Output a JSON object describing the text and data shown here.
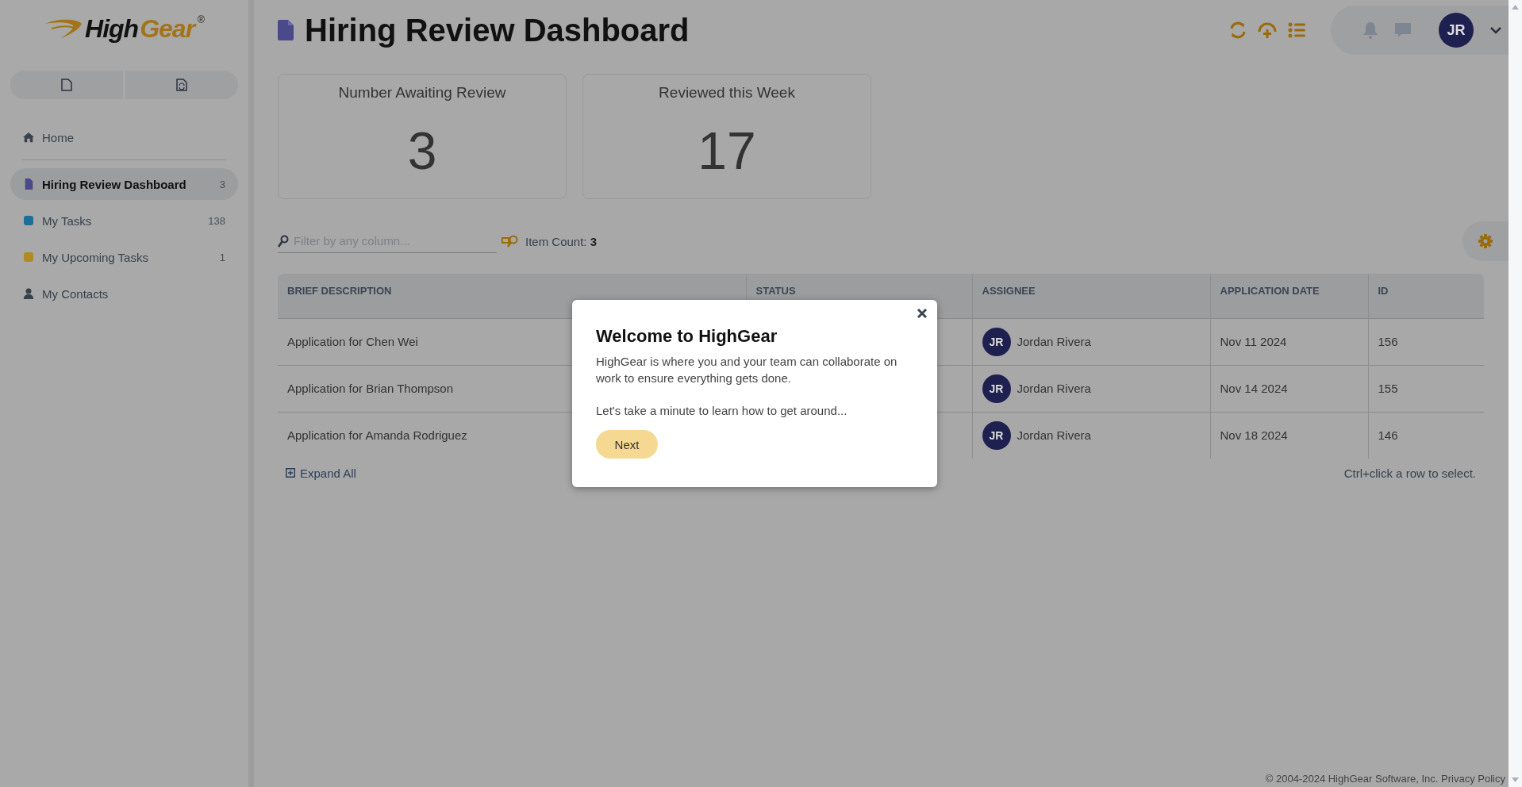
{
  "logo": {
    "part_1": "High",
    "part_2": "Gear",
    "mark": "®"
  },
  "sidebar": {
    "items": [
      {
        "kind": "home",
        "label": "Home",
        "selected": false
      },
      {
        "kind": "page",
        "label": "Hiring Review Dashboard",
        "count": "3",
        "selected": true
      },
      {
        "kind": "dot",
        "label": "My Tasks",
        "count": "138",
        "color": "#1f6e9a",
        "selected": false
      },
      {
        "kind": "dot",
        "label": "My Upcoming Tasks",
        "count": "1",
        "color": "#b08a22",
        "selected": false
      },
      {
        "kind": "contact",
        "label": "My Contacts",
        "selected": false
      }
    ]
  },
  "header": {
    "title": "Hiring Review Dashboard",
    "avatar": "JR"
  },
  "stats": [
    {
      "label": "Number Awaiting Review",
      "value": "3"
    },
    {
      "label": "Reviewed this Week",
      "value": "17"
    }
  ],
  "filter": {
    "placeholder": "Filter by any column..."
  },
  "item_count": {
    "label": "Item Count:",
    "value": "3"
  },
  "table": {
    "columns": [
      "BRIEF DESCRIPTION",
      "STATUS",
      "ASSIGNEE",
      "APPLICATION DATE",
      "ID"
    ],
    "rows": [
      {
        "description": "Application for Chen Wei",
        "avatar": "JR",
        "assignee": "Jordan Rivera",
        "date": "Nov 11 2024",
        "id": "156"
      },
      {
        "description": "Application for Brian Thompson",
        "avatar": "JR",
        "assignee": "Jordan Rivera",
        "date": "Nov 14 2024",
        "id": "155"
      },
      {
        "description": "Application for Amanda Rodriguez",
        "avatar": "JR",
        "assignee": "Jordan Rivera",
        "date": "Nov 18 2024",
        "id": "146"
      }
    ]
  },
  "expand_all": "Expand All",
  "hint": "Ctrl+click a row to select.",
  "footer": {
    "copyright": "© 2004-2024 HighGear Software, Inc.",
    "link": "Privacy Policy"
  },
  "modal": {
    "title": "Welcome to HighGear",
    "paragraphs": [
      "HighGear is where you and your team can collaborate on work to ensure everything gets done.",
      "Let's take a minute to learn how to get around..."
    ],
    "button": "Next"
  }
}
